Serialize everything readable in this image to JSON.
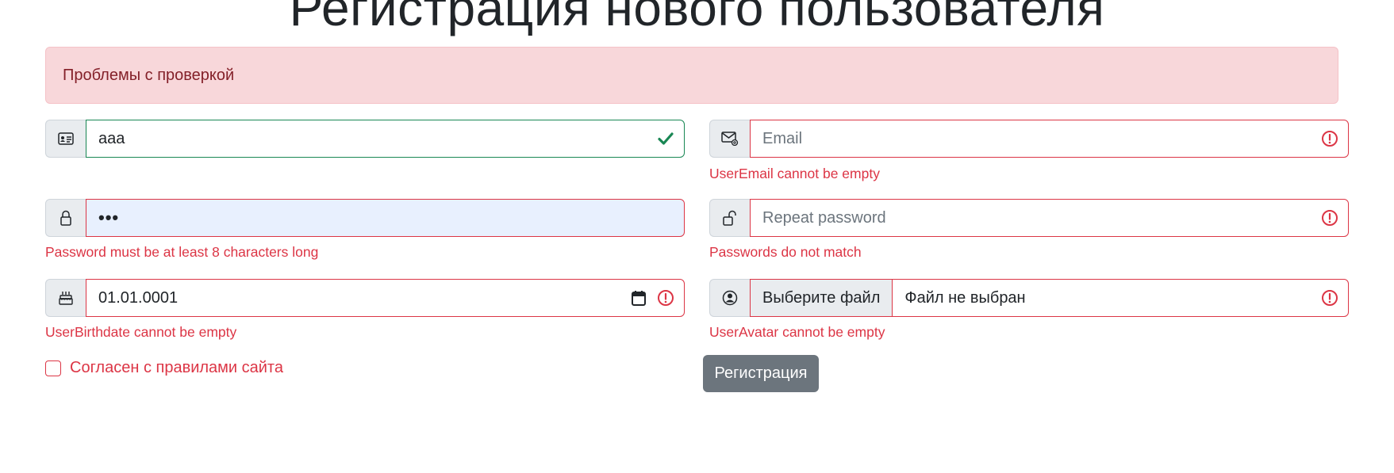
{
  "page": {
    "title": "Регистрация нового пользователя"
  },
  "alert": {
    "text": "Проблемы с проверкой"
  },
  "fields": {
    "username": {
      "value": "aaa",
      "state": "valid"
    },
    "email": {
      "placeholder": "Email",
      "error": "UserEmail cannot be empty"
    },
    "password": {
      "value": "•••",
      "error": "Password must be at least 8 characters long"
    },
    "repeat_password": {
      "placeholder": "Repeat password",
      "error": "Passwords do not match"
    },
    "birthdate": {
      "value": "01.01.0001",
      "error": "UserBirthdate cannot be empty"
    },
    "avatar": {
      "button_label": "Выберите файл",
      "file_text": "Файл не выбран",
      "error": "UserAvatar cannot be empty"
    }
  },
  "agree": {
    "label": "Согласен с правилами сайта"
  },
  "submit": {
    "label": "Регистрация"
  },
  "colors": {
    "invalid": "#dc3545",
    "valid": "#198754",
    "alert_bg": "#f8d7da",
    "alert_text": "#842029",
    "button_bg": "#6c757d"
  },
  "icons": {
    "username": "id-card-icon",
    "email": "envelope-at-icon",
    "password": "lock-icon",
    "repeat_password": "unlock-icon",
    "birthdate": "cake-icon",
    "avatar": "person-circle-icon",
    "valid": "check-icon",
    "invalid": "exclamation-circle-icon",
    "calendar": "calendar-icon"
  }
}
